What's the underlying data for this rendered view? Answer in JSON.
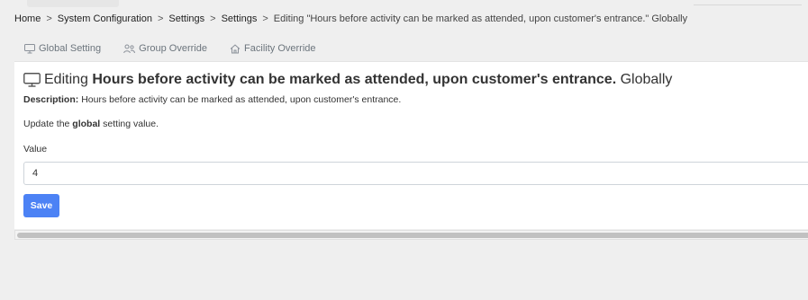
{
  "breadcrumb": {
    "items": [
      "Home",
      "System Configuration",
      "Settings",
      "Settings"
    ],
    "separator": ">",
    "current": "Editing \"Hours before activity can be marked as attended, upon customer's entrance.\" Globally"
  },
  "tabs": [
    {
      "label": "Global Setting",
      "icon": "monitor-icon"
    },
    {
      "label": "Group Override",
      "icon": "users-icon"
    },
    {
      "label": "Facility Override",
      "icon": "home-icon"
    }
  ],
  "editor": {
    "heading_prefix": "Editing",
    "heading_setting": "Hours before activity can be marked as attended, upon customer's entrance.",
    "heading_suffix": "Globally",
    "description_label": "Description:",
    "description_text": "Hours before activity can be marked as attended, upon customer's entrance.",
    "update_prefix": "Update the",
    "update_scope": "global",
    "update_suffix": "setting value.",
    "value_label": "Value",
    "value": "4",
    "save_label": "Save"
  },
  "colors": {
    "page_background": "#efefef",
    "primary_button": "#4c82f5",
    "tab_text": "#6c757d"
  }
}
